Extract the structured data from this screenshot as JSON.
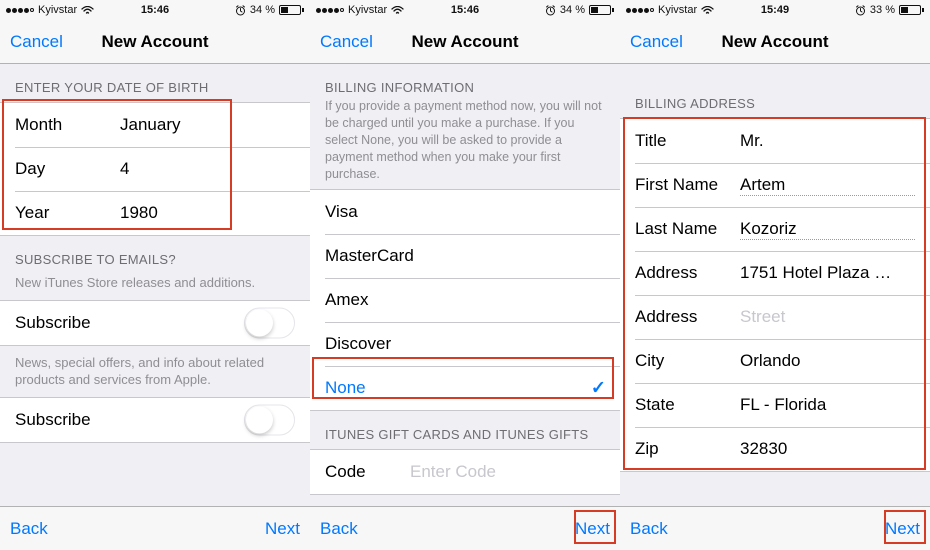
{
  "screens": [
    {
      "status": {
        "carrier": "Kyivstar",
        "time": "15:46",
        "batt_pct": "34 %"
      },
      "nav": {
        "cancel": "Cancel",
        "title": "New Account"
      },
      "dob_header": "ENTER YOUR DATE OF BIRTH",
      "dob": {
        "month_label": "Month",
        "month_value": "January",
        "day_label": "Day",
        "day_value": "4",
        "year_label": "Year",
        "year_value": "1980"
      },
      "emails_header": "SUBSCRIBE TO EMAILS?",
      "emails_sub": "New iTunes Store releases and additions.",
      "subscribe1": "Subscribe",
      "offers_sub": "News, special offers, and info about related products and services from Apple.",
      "subscribe2": "Subscribe",
      "back": "Back",
      "next": "Next"
    },
    {
      "status": {
        "carrier": "Kyivstar",
        "time": "15:46",
        "batt_pct": "34 %"
      },
      "nav": {
        "cancel": "Cancel",
        "title": "New Account"
      },
      "billing_header": "BILLING INFORMATION",
      "billing_sub": "If you provide a payment method now, you will not be charged until you make a purchase. If you select None, you will be asked to provide a payment method when you make your first purchase.",
      "cards": [
        "Visa",
        "MasterCard",
        "Amex",
        "Discover",
        "None"
      ],
      "gift_header": "ITUNES GIFT CARDS AND ITUNES GIFTS",
      "gift": {
        "code_label": "Code",
        "code_placeholder": "Enter Code"
      },
      "back": "Back",
      "next": "Next"
    },
    {
      "status": {
        "carrier": "Kyivstar",
        "time": "15:49",
        "batt_pct": "33 %"
      },
      "nav": {
        "cancel": "Cancel",
        "title": "New Account"
      },
      "addr_header": "BILLING ADDRESS",
      "addr": {
        "title_label": "Title",
        "title_value": "Mr.",
        "first_label": "First Name",
        "first_value": "Artem",
        "last_label": "Last Name",
        "last_value": "Kozoriz",
        "addr1_label": "Address",
        "addr1_value": "1751 Hotel Plaza …",
        "addr2_label": "Address",
        "addr2_placeholder": "Street",
        "city_label": "City",
        "city_value": "Orlando",
        "state_label": "State",
        "state_value": "FL - Florida",
        "zip_label": "Zip",
        "zip_value": "32830"
      },
      "back": "Back",
      "next": "Next"
    }
  ]
}
